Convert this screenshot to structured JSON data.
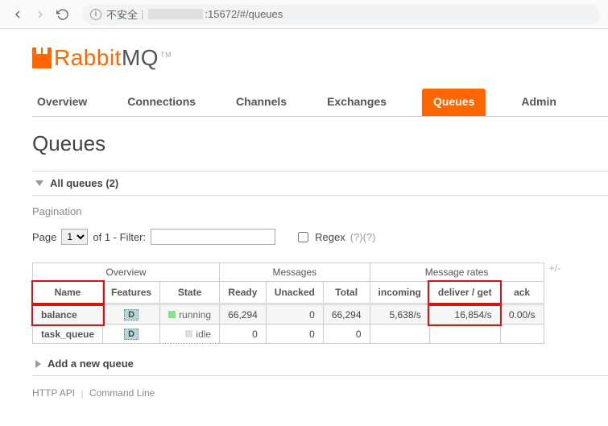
{
  "browser": {
    "insecure_label": "不安全",
    "url_suffix": ":15672/#/queues"
  },
  "logo": {
    "part1": "Rabbit",
    "part2": "MQ",
    "tm": "TM"
  },
  "nav": {
    "overview": "Overview",
    "connections": "Connections",
    "channels": "Channels",
    "exchanges": "Exchanges",
    "queues": "Queues",
    "admin": "Admin"
  },
  "heading": "Queues",
  "section_all": "All queues (2)",
  "pagination_label": "Pagination",
  "pager": {
    "page_label": "Page",
    "page_value": "1",
    "of_label": "of 1  - Filter:",
    "filter_value": "",
    "regex_label": "Regex",
    "regex_hint": "(?)(?)"
  },
  "table": {
    "group_overview": "Overview",
    "group_messages": "Messages",
    "group_rates": "Message rates",
    "plusminus": "+/-",
    "cols": {
      "name": "Name",
      "features": "Features",
      "state": "State",
      "ready": "Ready",
      "unacked": "Unacked",
      "total": "Total",
      "incoming": "incoming",
      "deliver": "deliver / get",
      "ack": "ack"
    },
    "rows": [
      {
        "name": "balance",
        "feature": "D",
        "state": "running",
        "state_kind": "run",
        "ready": "66,294",
        "unacked": "0",
        "total": "66,294",
        "incoming": "5,638/s",
        "deliver": "16,854/s",
        "ack": "0.00/s"
      },
      {
        "name": "task_queue",
        "feature": "D",
        "state": "idle",
        "state_kind": "idle",
        "ready": "0",
        "unacked": "0",
        "total": "0",
        "incoming": "",
        "deliver": "",
        "ack": ""
      }
    ]
  },
  "section_add": "Add a new queue",
  "footer": {
    "api": "HTTP API",
    "cli": "Command Line"
  }
}
